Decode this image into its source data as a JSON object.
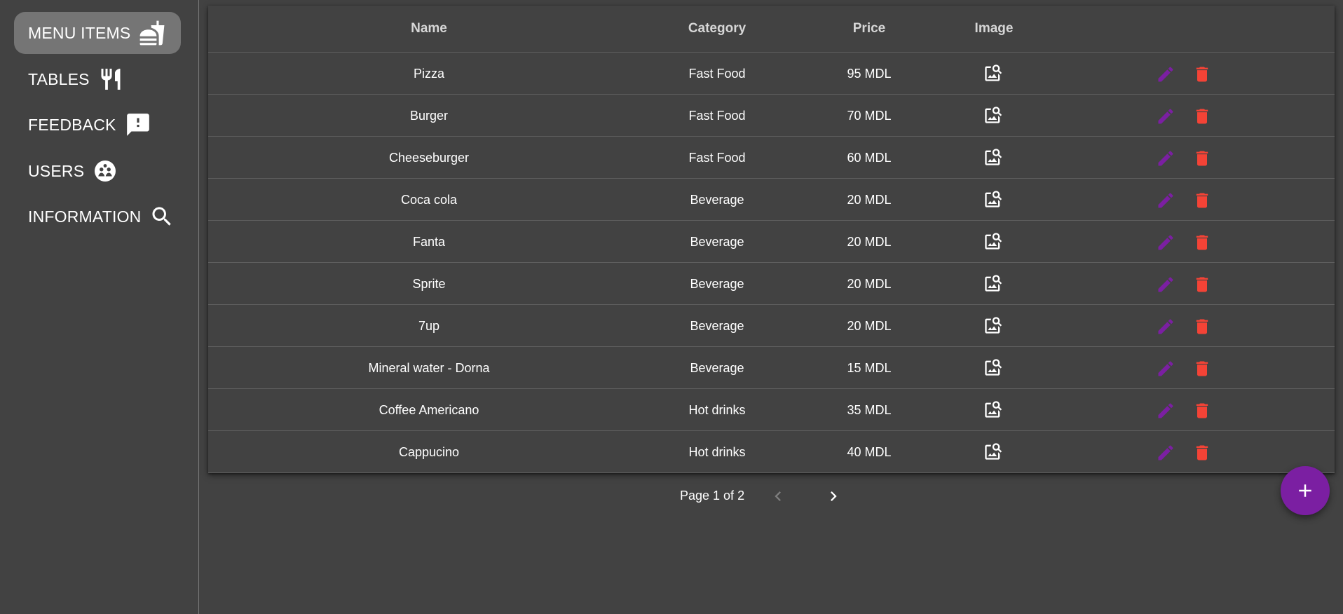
{
  "sidebar": {
    "items": [
      {
        "label": "MENU ITEMS",
        "icon": "fastfood-icon",
        "active": true
      },
      {
        "label": "TABLES",
        "icon": "restaurant-icon",
        "active": false
      },
      {
        "label": "FEEDBACK",
        "icon": "feedback-icon",
        "active": false
      },
      {
        "label": "USERS",
        "icon": "users-icon",
        "active": false
      },
      {
        "label": "INFORMATION",
        "icon": "search-icon",
        "active": false
      }
    ]
  },
  "table": {
    "headers": {
      "name": "Name",
      "category": "Category",
      "price": "Price",
      "image": "Image"
    },
    "rows": [
      {
        "name": "Pizza",
        "category": "Fast Food",
        "price": "95 MDL"
      },
      {
        "name": "Burger",
        "category": "Fast Food",
        "price": "70 MDL"
      },
      {
        "name": "Cheeseburger",
        "category": "Fast Food",
        "price": "60 MDL"
      },
      {
        "name": "Coca cola",
        "category": "Beverage",
        "price": "20 MDL"
      },
      {
        "name": "Fanta",
        "category": "Beverage",
        "price": "20 MDL"
      },
      {
        "name": "Sprite",
        "category": "Beverage",
        "price": "20 MDL"
      },
      {
        "name": "7up",
        "category": "Beverage",
        "price": "20 MDL"
      },
      {
        "name": "Mineral water - Dorna",
        "category": "Beverage",
        "price": "15 MDL"
      },
      {
        "name": "Coffee Americano",
        "category": "Hot drinks",
        "price": "35 MDL"
      },
      {
        "name": "Cappucino",
        "category": "Hot drinks",
        "price": "40 MDL"
      }
    ]
  },
  "pagination": {
    "text": "Page 1 of 2"
  },
  "colors": {
    "accent": "#7b1fa2",
    "delete": "#f44336",
    "edit": "#7b1fa2",
    "background": "#424242"
  }
}
